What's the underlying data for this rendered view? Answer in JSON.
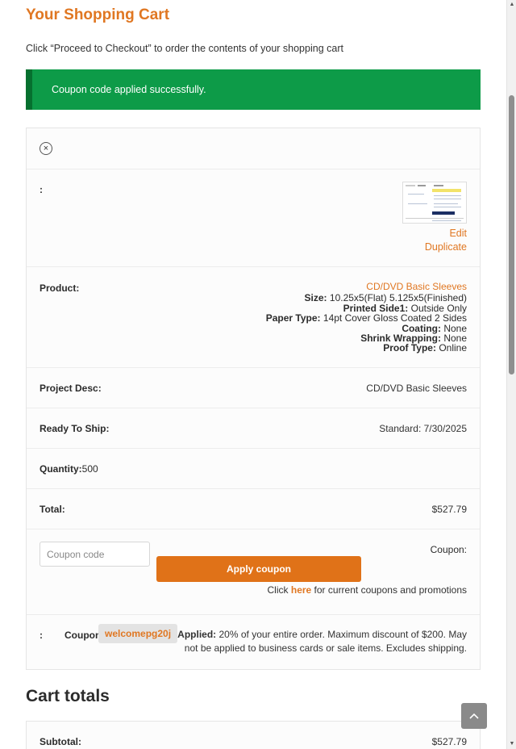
{
  "page": {
    "title": "Your Shopping Cart",
    "intro": "Click “Proceed to Checkout” to order the contents of your shopping cart"
  },
  "notice": {
    "message": "Coupon code applied successfully.",
    "color": "#0d9b48"
  },
  "cart_item": {
    "remove_icon": "×",
    "thumb_label": ":",
    "edit_label": "Edit",
    "duplicate_label": "Duplicate",
    "product": {
      "label": "Product:",
      "name": "CD/DVD Basic Sleeves",
      "specs": [
        {
          "key": "Size:",
          "value": "10.25x5(Flat) 5.125x5(Finished)"
        },
        {
          "key": "Printed Side1:",
          "value": "Outside Only"
        },
        {
          "key": "Paper Type:",
          "value": "14pt Cover Gloss Coated 2 Sides"
        },
        {
          "key": "Coating:",
          "value": "None"
        },
        {
          "key": "Shrink Wrapping:",
          "value": "None"
        },
        {
          "key": "Proof Type:",
          "value": "Online"
        }
      ]
    },
    "project_desc": {
      "label": "Project Desc:",
      "value": "CD/DVD Basic Sleeves"
    },
    "ready_to_ship": {
      "label": "Ready To Ship:",
      "value": "Standard: 7/30/2025"
    },
    "quantity": {
      "label": "Quantity:",
      "value": "500"
    },
    "total": {
      "label": "Total:",
      "value": "$527.79"
    }
  },
  "coupon": {
    "placeholder": "Coupon code",
    "label": "Coupon:",
    "apply_label": "Apply coupon",
    "help_prefix": "Click ",
    "help_link": "here",
    "help_suffix": " for current coupons and promotions"
  },
  "applied_coupon": {
    "colon": ":",
    "coupon_word": "Coupon",
    "code": "welcomepg20j",
    "applied_label": "Applied:",
    "description": " 20% of your entire order. Maximum discount of $200. May not be applied to business cards or sale items. Excludes shipping."
  },
  "cart_totals": {
    "title": "Cart totals",
    "subtotal_label": "Subtotal:",
    "subtotal_value": "$527.79"
  },
  "colors": {
    "accent": "#e07722",
    "button": "#e07218",
    "success": "#0d9b48"
  },
  "icons": {
    "remove": "close-circle-icon",
    "scroll_top": "chevron-up-icon"
  }
}
